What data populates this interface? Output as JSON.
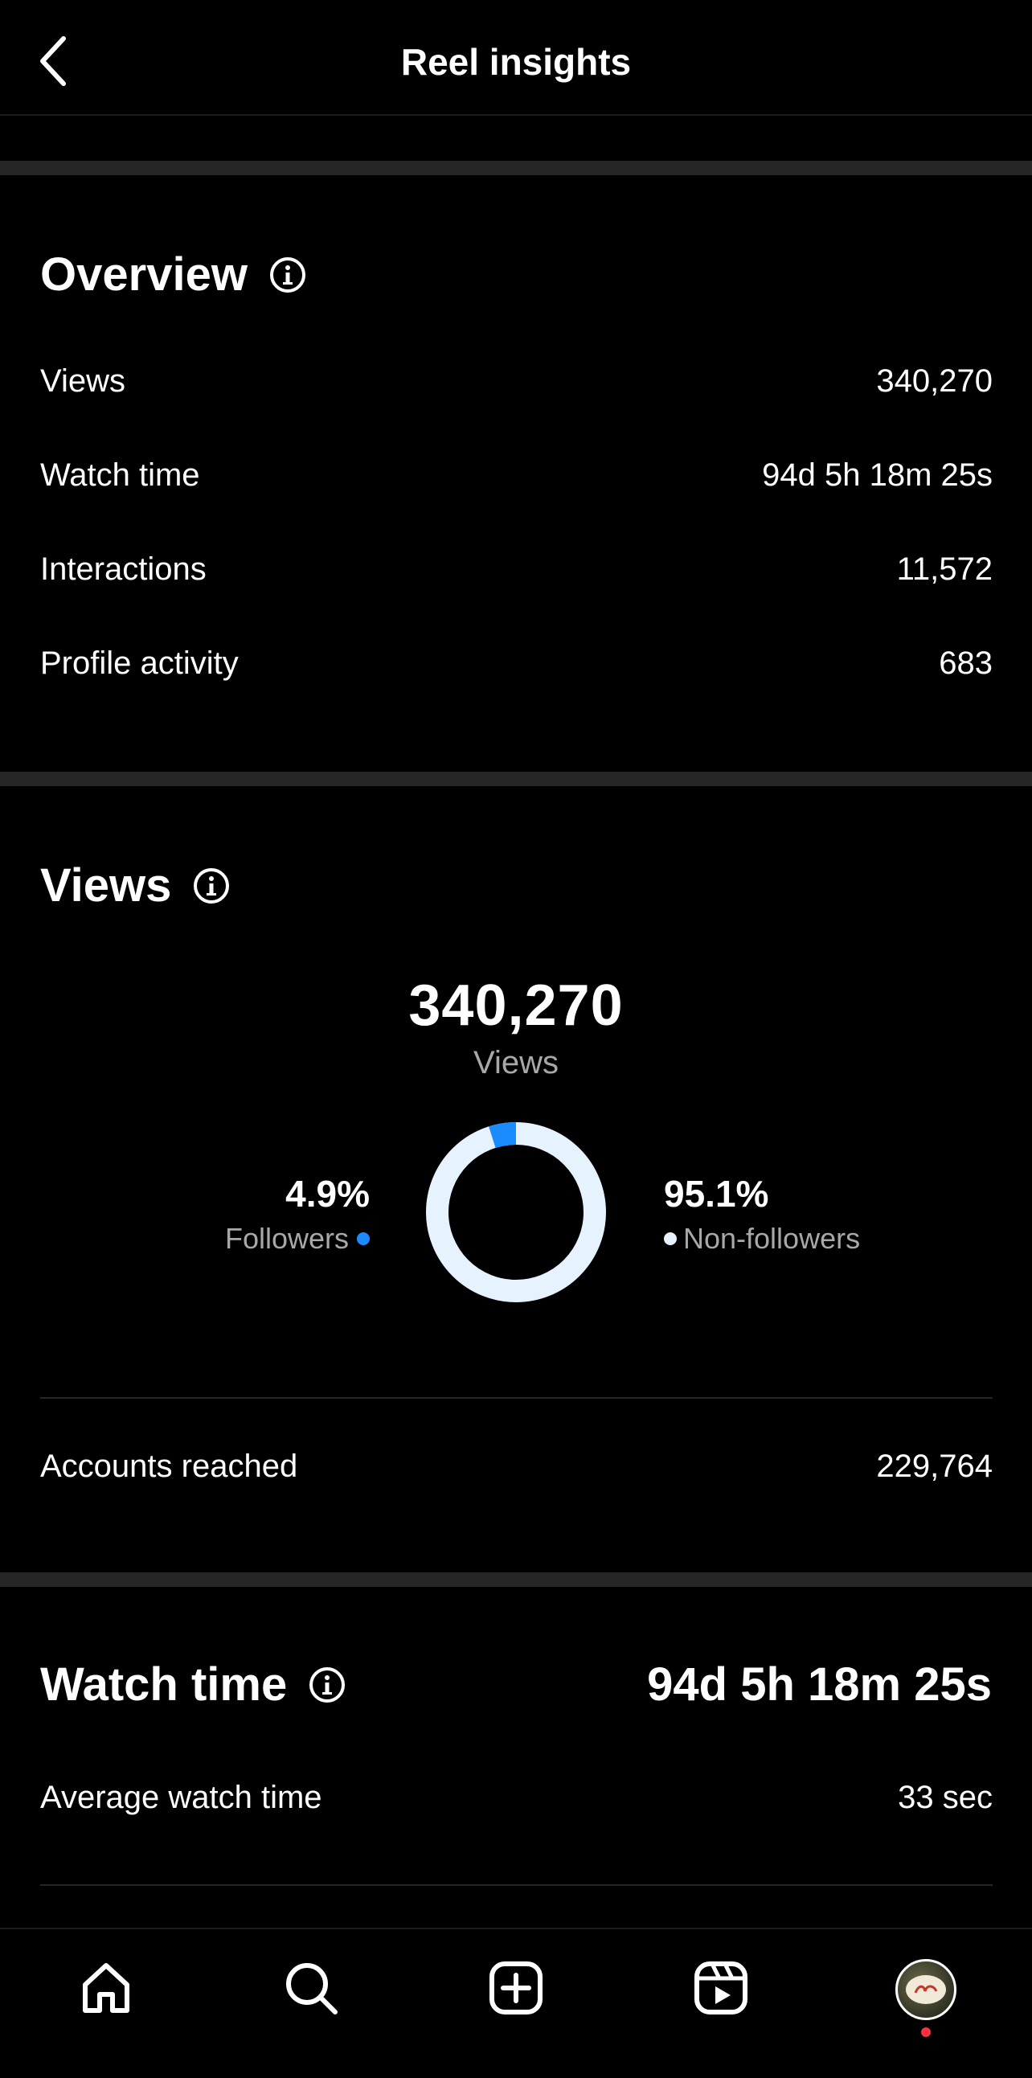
{
  "header": {
    "title": "Reel insights"
  },
  "overview": {
    "title": "Overview",
    "rows": [
      {
        "label": "Views",
        "value": "340,270"
      },
      {
        "label": "Watch time",
        "value": "94d 5h 18m 25s"
      },
      {
        "label": "Interactions",
        "value": "11,572"
      },
      {
        "label": "Profile activity",
        "value": "683"
      }
    ]
  },
  "views": {
    "title": "Views",
    "total": "340,270",
    "total_label": "Views",
    "followers": {
      "percent": "4.9%",
      "label": "Followers",
      "fraction": 0.049
    },
    "non_followers": {
      "percent": "95.1%",
      "label": "Non-followers",
      "fraction": 0.951
    },
    "accounts_reached_label": "Accounts reached",
    "accounts_reached_value": "229,764"
  },
  "watch_time": {
    "title": "Watch time",
    "value": "94d 5h 18m 25s",
    "average_label": "Average watch time",
    "average_value": "33 sec"
  },
  "colors": {
    "followers": "#1a8cff",
    "non_followers": "#e6f3ff",
    "background": "#000000",
    "divider": "#262626",
    "secondary_text": "#a8a8a8"
  },
  "nav": {
    "items": [
      "home-icon",
      "search-icon",
      "create-icon",
      "reels-icon",
      "profile-avatar"
    ]
  }
}
